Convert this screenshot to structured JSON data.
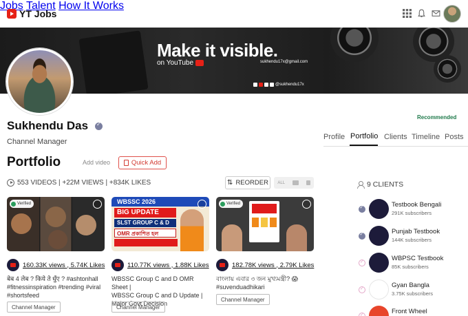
{
  "header": {
    "logo_text": "YT Jobs",
    "nav": [
      "Jobs",
      "Talent",
      "How It Works"
    ],
    "icons": [
      "grid-icon",
      "bell-icon",
      "mail-icon"
    ]
  },
  "banner": {
    "title": "Make it visible.",
    "subtitle": "on YouTube",
    "email": "sukhendu17x@gmail.com",
    "handle": "@sukhendu17x"
  },
  "profile": {
    "name": "Sukhendu Das",
    "role": "Channel Manager",
    "recommended": "Recommended",
    "tabs": [
      "Profile",
      "Portfolio",
      "Clients",
      "Timeline",
      "Posts"
    ],
    "active_tab": "Portfolio"
  },
  "portfolio": {
    "heading": "Portfolio",
    "add_video": "Add video",
    "quick_add": "Quick Add",
    "stats": "553 VIDEOS | +22M VIEWS | +834K LIKES",
    "reorder": "REORDER",
    "view_all": "ALL",
    "cards": [
      {
        "badge": "Verified",
        "stats": "160.33K views , 5.74K Likes",
        "desc_lines": [
          "बेब 4 लेब ? किये ते धुँए ? #ashtonhall",
          "#fitnessinspiration #trending #viral",
          "#shortsfeed"
        ],
        "tag": "Channel Manager"
      },
      {
        "badge": "",
        "thumb_text": [
          "WBSSC 2026",
          "BIG UPDATE",
          "SLST GROUP C & D",
          "OMR প্রকাশিত হল"
        ],
        "stats": "110.77K views , 1.88K Likes",
        "desc_lines": [
          "WBSSC Group C and D OMR Sheet |",
          "WBSSC Group C and D Update |",
          "Major Govt Decision"
        ],
        "tag": "Channel Manager"
      },
      {
        "badge": "Verified",
        "stats": "182.78K views , 2.79K Likes",
        "desc_lines": [
          "বাংলায় এবার ৩ জন মুখ্যমন্ত্রী? 😱",
          "#suvenduadhikari"
        ],
        "tag": "Channel Manager"
      }
    ]
  },
  "clients": {
    "heading": "9 CLIENTS",
    "items": [
      {
        "name": "Testbook Bengali",
        "subs": "291K subscribers",
        "checked": true,
        "color": "#1d1b3a"
      },
      {
        "name": "Punjab Testbook",
        "subs": "144K subscribers",
        "checked": true,
        "color": "#1d1b3a"
      },
      {
        "name": "WBPSC Testbook",
        "subs": "85K subscribers",
        "checked": false,
        "color": "#1d1b3a"
      },
      {
        "name": "Gyan Bangla",
        "subs": "3.75K subscribers",
        "checked": false,
        "color": "#ffffff"
      },
      {
        "name": "Front Wheel",
        "subs": "",
        "checked": false,
        "color": "#e8452b"
      }
    ]
  }
}
